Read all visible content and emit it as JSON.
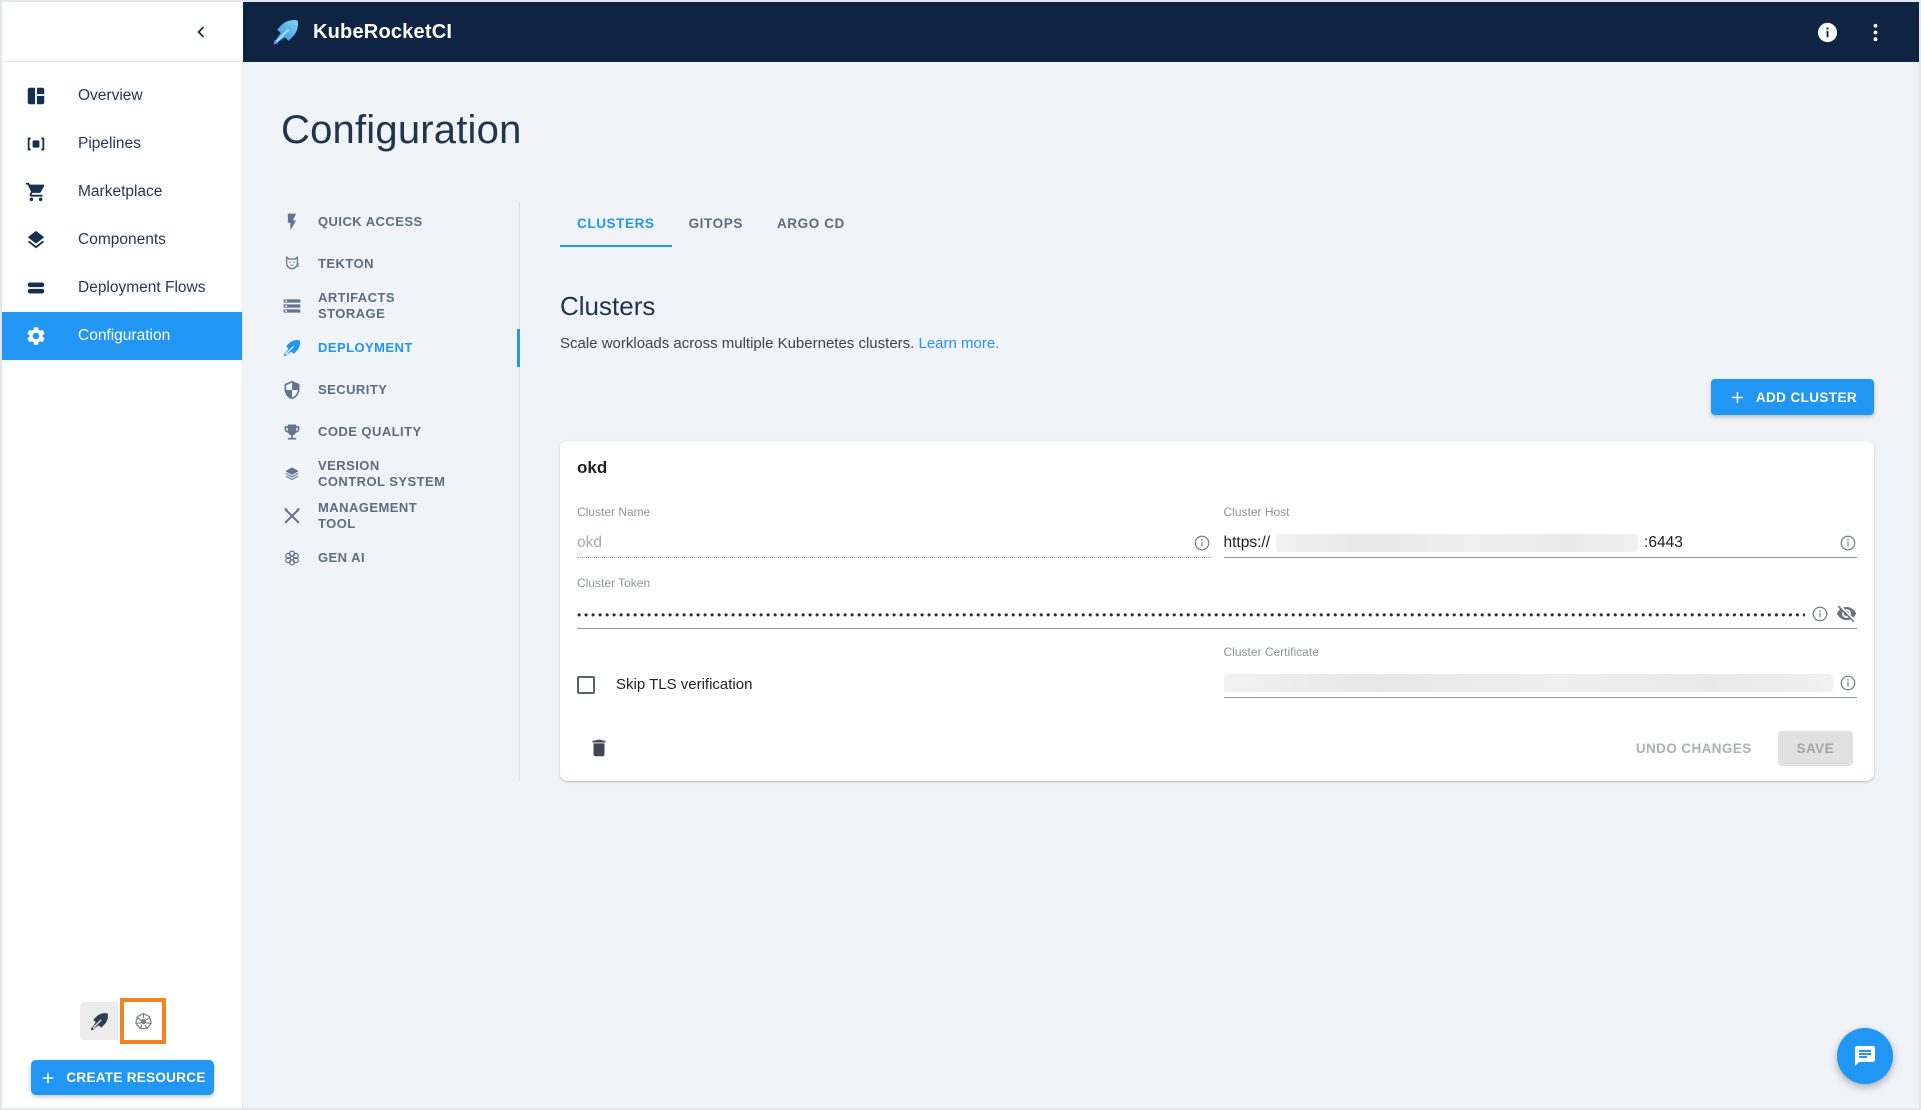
{
  "colors": {
    "primary": "#2196f3",
    "header_bg": "#0e2442",
    "highlight_orange": "#f5821f",
    "page_bg": "#f0f3f8"
  },
  "topbar": {
    "app_title": "KubeRocketCI"
  },
  "sidebar": {
    "items": [
      {
        "label": "Overview",
        "icon": "dashboard-icon",
        "active": false
      },
      {
        "label": "Pipelines",
        "icon": "pipelines-icon",
        "active": false
      },
      {
        "label": "Marketplace",
        "icon": "cart-icon",
        "active": false
      },
      {
        "label": "Components",
        "icon": "layers-icon",
        "active": false
      },
      {
        "label": "Deployment Flows",
        "icon": "flows-icon",
        "active": false
      },
      {
        "label": "Configuration",
        "icon": "gear-icon",
        "active": true
      }
    ],
    "footer": {
      "create_resource_label": "CREATE RESOURCE",
      "mini_buttons": [
        "quill-icon",
        "kubernetes-icon"
      ],
      "kubernetes_button_highlighted": true
    }
  },
  "page": {
    "title": "Configuration",
    "subnav": [
      {
        "label": "QUICK ACCESS",
        "icon": "flash-icon",
        "active": false
      },
      {
        "label": "TEKTON",
        "icon": "tekton-cat-icon",
        "active": false
      },
      {
        "label": "ARTIFACTS STORAGE",
        "icon": "storage-icon",
        "active": false
      },
      {
        "label": "DEPLOYMENT",
        "icon": "rocket-quill-icon",
        "active": true
      },
      {
        "label": "SECURITY",
        "icon": "shield-icon",
        "active": false
      },
      {
        "label": "CODE QUALITY",
        "icon": "trophy-icon",
        "active": false
      },
      {
        "label": "VERSION CONTROL SYSTEM",
        "icon": "stack-icon",
        "active": false
      },
      {
        "label": "MANAGEMENT TOOL",
        "icon": "tools-icon",
        "active": false
      },
      {
        "label": "GEN AI",
        "icon": "genai-icon",
        "active": false
      }
    ],
    "tabs": [
      {
        "label": "CLUSTERS",
        "active": true
      },
      {
        "label": "GITOPS",
        "active": false
      },
      {
        "label": "ARGO CD",
        "active": false
      }
    ],
    "section": {
      "heading": "Clusters",
      "description": "Scale workloads across multiple Kubernetes clusters.",
      "learn_more_label": "Learn more.",
      "add_button_label": "ADD CLUSTER"
    },
    "cluster_card": {
      "title": "okd",
      "fields": {
        "cluster_name": {
          "label": "Cluster Name",
          "value": "okd",
          "disabled": true
        },
        "cluster_host": {
          "label": "Cluster Host",
          "value_prefix": "https://",
          "value_redacted": true,
          "value_suffix": ":6443"
        },
        "cluster_token": {
          "label": "Cluster Token",
          "masked": true,
          "masked_display": "••••••••••••••••••••••••••••••••••••••••••••••••••••••••••••••••••••••••••••••••••••••••••••••••••••••••••••••••••••••••••••••••••••••••••••••••••••••••••••••••••••••••••••••••••••••••••••••••••••••••"
        },
        "skip_tls": {
          "label": "Skip TLS verification",
          "checked": false
        },
        "cluster_certificate": {
          "label": "Cluster Certificate",
          "value_redacted": true
        }
      },
      "actions": {
        "undo_label": "UNDO CHANGES",
        "save_label": "SAVE",
        "undo_disabled": true,
        "save_disabled": true
      }
    }
  }
}
